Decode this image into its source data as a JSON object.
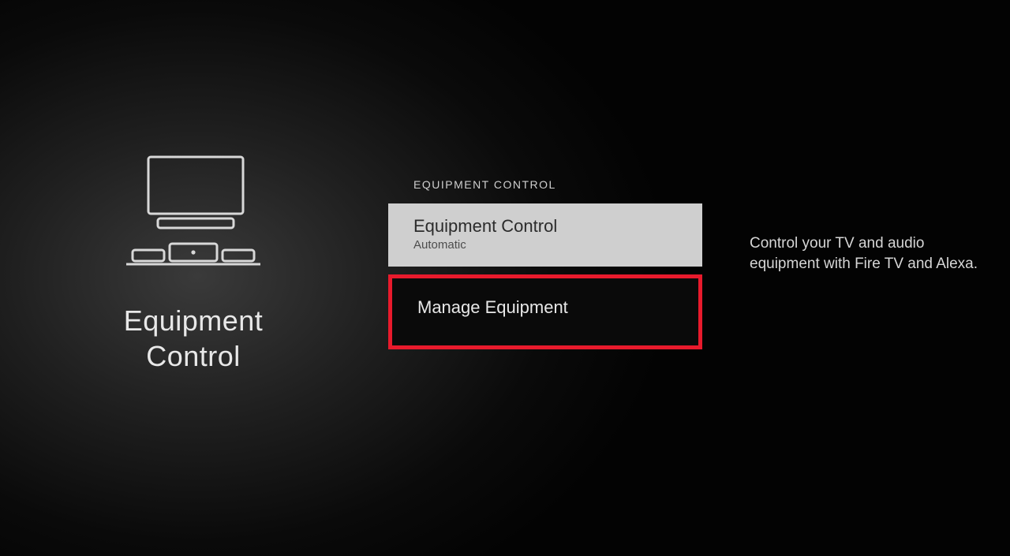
{
  "section": {
    "title_line1": "Equipment",
    "title_line2": "Control"
  },
  "menu": {
    "heading": "EQUIPMENT CONTROL",
    "items": [
      {
        "title": "Equipment Control",
        "subtitle": "Automatic"
      },
      {
        "title": "Manage Equipment"
      }
    ]
  },
  "description": "Control your TV and audio equipment with Fire TV and Alexa."
}
